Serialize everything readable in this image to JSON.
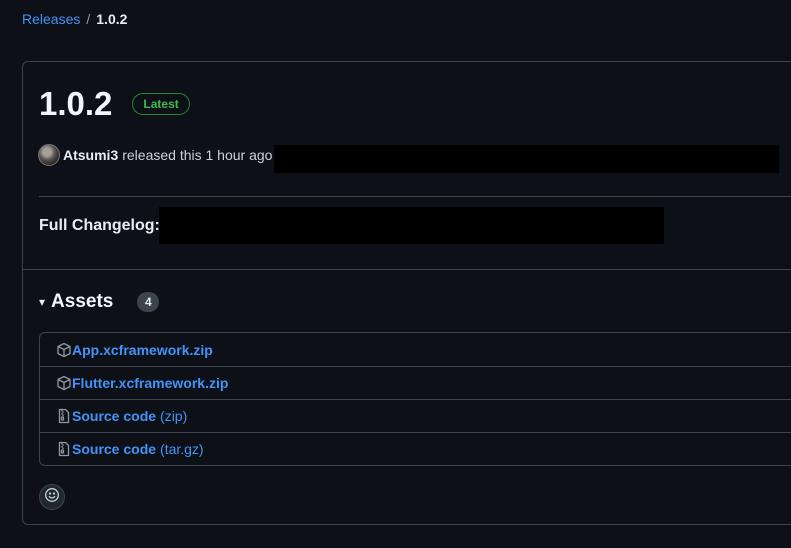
{
  "breadcrumb": {
    "root": "Releases",
    "separator": "/",
    "current": "1.0.2"
  },
  "release": {
    "title": "1.0.2",
    "badge": "Latest",
    "author": "Atsumi3",
    "released_text": "released this 1 hour ago",
    "changelog_label": "Full Changelog:"
  },
  "assets": {
    "title": "Assets",
    "toggle_glyph": "▾",
    "count": "4",
    "items": [
      {
        "icon": "package-icon",
        "name": "App.xcframework.zip",
        "suffix": ""
      },
      {
        "icon": "package-icon",
        "name": "Flutter.xcframework.zip",
        "suffix": ""
      },
      {
        "icon": "file-zip-icon",
        "name": "Source code",
        "suffix": "(zip)"
      },
      {
        "icon": "file-zip-icon",
        "name": "Source code",
        "suffix": "(tar.gz)"
      }
    ]
  },
  "colors": {
    "background": "#0d1117",
    "link": "#4493f8",
    "badge_green": "#3fb950",
    "border": "#3d444d"
  },
  "reaction": {
    "icon": "smiley-icon"
  }
}
